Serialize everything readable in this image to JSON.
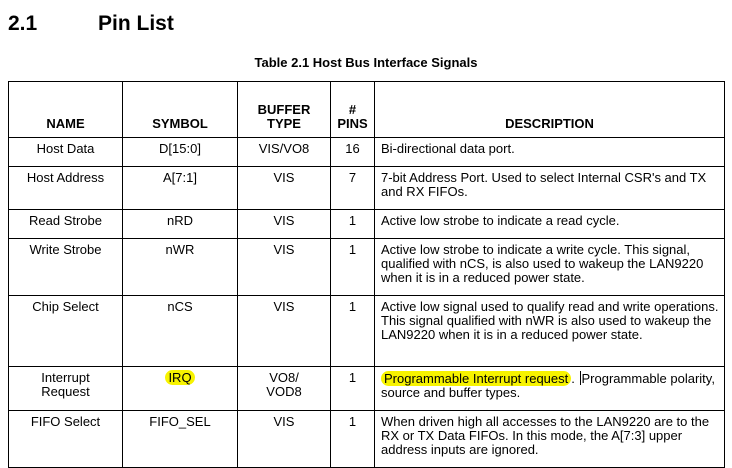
{
  "section": {
    "number": "2.1",
    "title": "Pin List"
  },
  "caption": "Table 2.1  Host Bus Interface Signals",
  "columns": {
    "name": "NAME",
    "symbol": "SYMBOL",
    "buffer_type_line1": "BUFFER",
    "buffer_type_line2": "TYPE",
    "pins_line1": "#",
    "pins_line2": "PINS",
    "description": "DESCRIPTION"
  },
  "rows": [
    {
      "name": "Host Data",
      "symbol": "D[15:0]",
      "buffer": "VIS/VO8",
      "pins": "16",
      "description": "Bi-directional data port."
    },
    {
      "name": "Host Address",
      "symbol": "A[7:1]",
      "buffer": "VIS",
      "pins": "7",
      "description": "7-bit Address Port. Used to select Internal CSR's and TX and RX FIFOs."
    },
    {
      "name": "Read Strobe",
      "symbol": "nRD",
      "buffer": "VIS",
      "pins": "1",
      "description": "Active low strobe to indicate a read cycle."
    },
    {
      "name": "Write Strobe",
      "symbol": "nWR",
      "buffer": "VIS",
      "pins": "1",
      "description": "Active low strobe to indicate a write cycle. This signal, qualified with nCS, is also used to wakeup the LAN9220 when it is in a reduced power state."
    },
    {
      "name": "Chip Select",
      "symbol": "nCS",
      "buffer": "VIS",
      "pins": "1",
      "description": "Active low signal used to qualify read and write operations. This signal qualified with nWR is also used to wakeup the LAN9220 when it is in a reduced power state."
    },
    {
      "name_line1": "Interrupt",
      "name_line2": "Request",
      "symbol": "IRQ",
      "buffer_line1": "VO8/",
      "buffer_line2": "VOD8",
      "pins": "1",
      "description_highlight": "Programmable Interrupt request",
      "description_rest_a": ".",
      "description_rest_b": "Programmable polarity, source and buffer types."
    },
    {
      "name": "FIFO Select",
      "symbol": "FIFO_SEL",
      "buffer": "VIS",
      "pins": "1",
      "description": "When driven high all accesses to the LAN9220 are to the RX or TX Data FIFOs. In this mode, the A[7:3] upper address inputs are ignored."
    }
  ],
  "colors": {
    "highlight": "#f7f300"
  }
}
